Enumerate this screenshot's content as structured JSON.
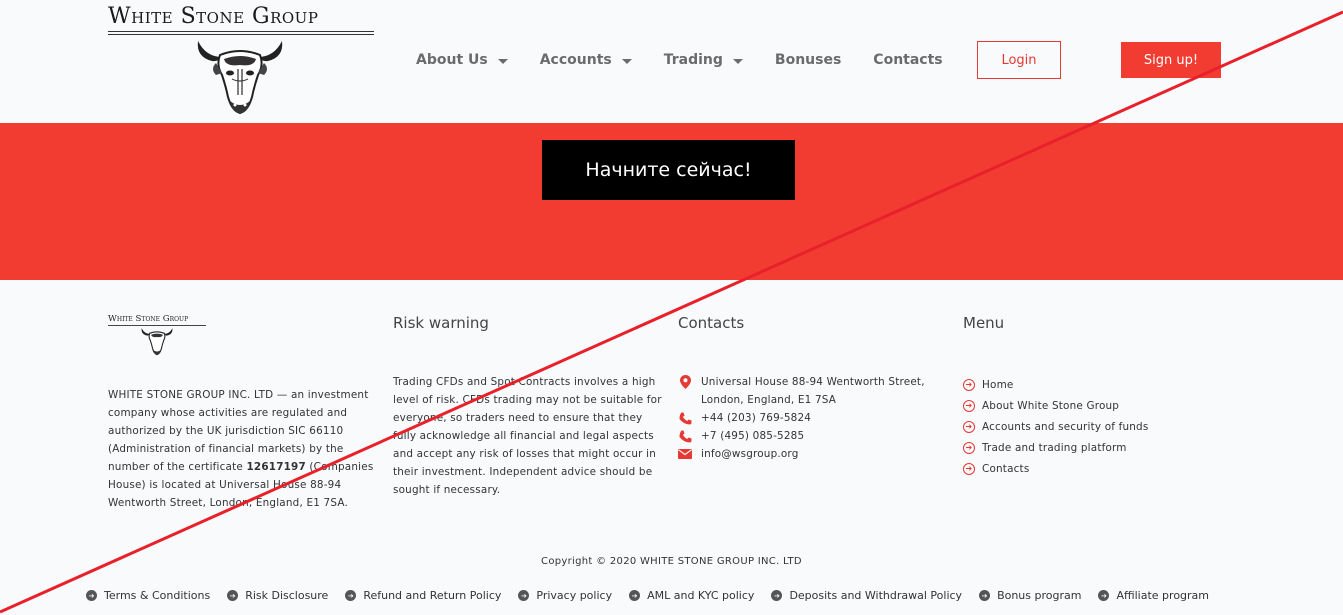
{
  "header": {
    "logo_text": "White Stone Group",
    "nav": [
      {
        "label": "About Us",
        "dropdown": true
      },
      {
        "label": "Accounts",
        "dropdown": true
      },
      {
        "label": "Trading",
        "dropdown": true
      },
      {
        "label": "Bonuses",
        "dropdown": false
      },
      {
        "label": "Contacts",
        "dropdown": false
      }
    ],
    "login_label": "Login",
    "signup_label": "Sign up!"
  },
  "band": {
    "cta_label": "Начните сейчас!"
  },
  "footer": {
    "about": {
      "logo_text": "White Stone Group",
      "text_before": "WHITE STONE GROUP INC. LTD — an investment company whose activities are regulated and authorized by the UK jurisdiction SIC 66110 (Administration of financial markets) by the number of the certificate ",
      "cert_number": "12617197",
      "text_after": " (Companies House) is located at Universal House 88-94 Wentworth Street, London, England, E1 7SA."
    },
    "risk": {
      "title": "Risk warning",
      "text": "Trading CFDs and Spot Contracts involves a high level of risk. CFDs trading may not be suitable for everyone, so traders need to ensure that they fully acknowledge all financial and legal aspects and accept any risk of losses that might occur in their investment. Independent advice should be sought if necessary."
    },
    "contacts": {
      "title": "Contacts",
      "address": "Universal House 88-94 Wentworth Street, London, England, E1 7SA",
      "phone1": "+44 (203) 769-5824",
      "phone2": "+7 (495) 085-5285",
      "email": "info@wsgroup.org"
    },
    "menu": {
      "title": "Menu",
      "items": [
        "Home",
        "About White Stone Group",
        "Accounts and security of funds",
        "Trade and trading platform",
        "Contacts"
      ]
    },
    "copyright": "Copyright © 2020 WHITE STONE GROUP INC. LTD",
    "bottom_links": [
      "Terms & Conditions",
      "Risk Disclosure",
      "Refund and Return Policy",
      "Privacy policy",
      "AML and KYC policy",
      "Deposits and Withdrawal Policy",
      "Bonus program",
      "Affiliate program"
    ]
  },
  "colors": {
    "accent_red": "#f23c32",
    "cta_black": "#000000",
    "nav_gray": "#6b6b6b",
    "overlay_line": "#e53935"
  }
}
